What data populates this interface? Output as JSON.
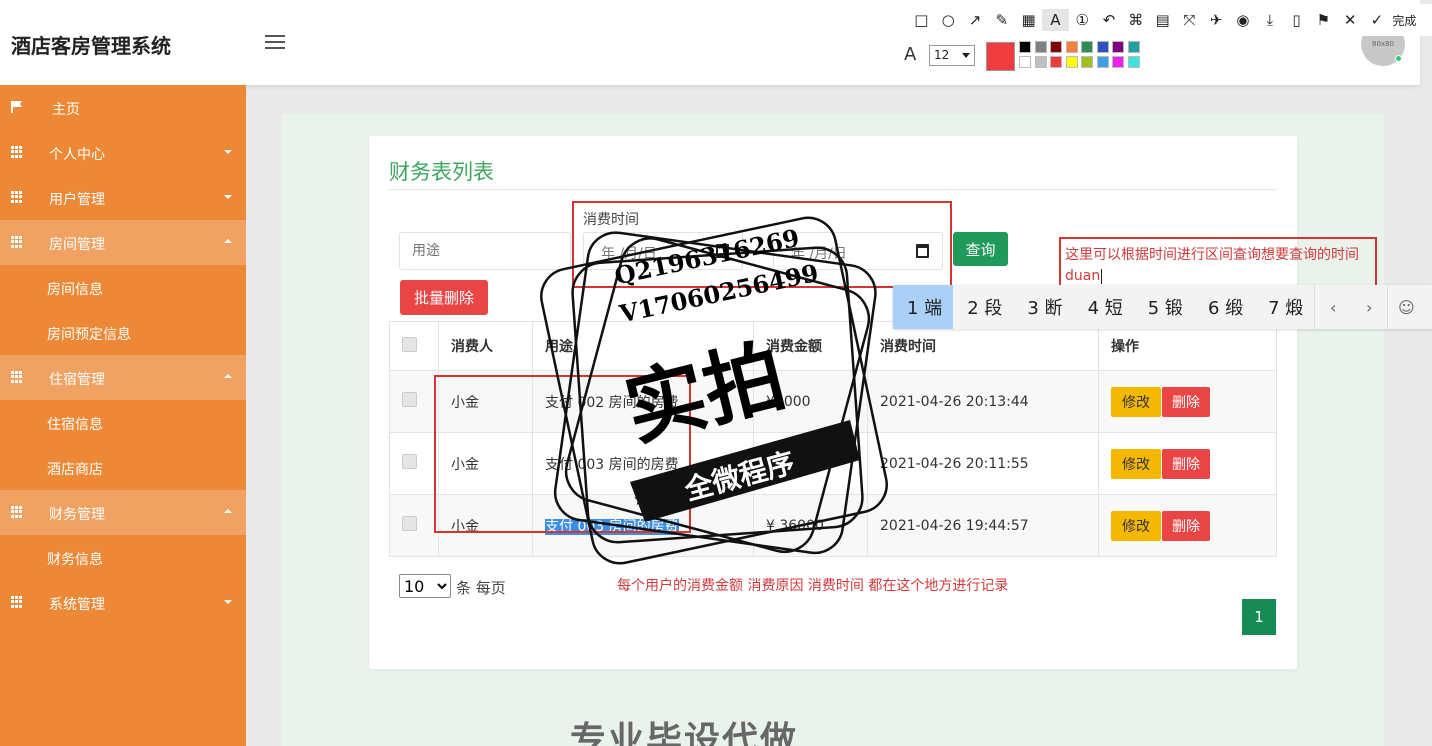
{
  "app": {
    "title": "酒店客房管理系统",
    "avatar_text": "80x80"
  },
  "sidebar": {
    "items": [
      {
        "label": "主页",
        "icon": "flag-icon"
      },
      {
        "label": "个人中心",
        "icon": "grid-icon"
      },
      {
        "label": "用户管理",
        "icon": "grid-icon"
      },
      {
        "label": "房间管理",
        "icon": "grid-icon"
      },
      {
        "label": "房间信息"
      },
      {
        "label": "房间预定信息"
      },
      {
        "label": "住宿管理",
        "icon": "grid-icon"
      },
      {
        "label": "住宿信息"
      },
      {
        "label": "酒店商店"
      },
      {
        "label": "财务管理",
        "icon": "grid-icon"
      },
      {
        "label": "财务信息"
      },
      {
        "label": "系统管理",
        "icon": "grid-icon"
      }
    ],
    "color": "#ed8936"
  },
  "main": {
    "title": "财务表列表",
    "search": {
      "purpose_placeholder": "用途",
      "time_label": "消费时间",
      "date_placeholder": "年 /月/日",
      "query_label": "查询"
    },
    "bulk_delete_label": "批量删除",
    "table": {
      "headers": [
        "消费人",
        "用途",
        "消费金额",
        "消费时间",
        "操作"
      ],
      "rows": [
        {
          "person": "小金",
          "purpose": "支付 002 房间的房费",
          "amount": "¥1000",
          "time": "2021-04-26 20:13:44"
        },
        {
          "person": "小金",
          "purpose": "支付 003 房间的房费",
          "amount": "¥1000",
          "time": "2021-04-26 20:11:55"
        },
        {
          "person": "小金",
          "purpose": "支付 003 房间的房费",
          "amount": "¥ 36000",
          "time": "2021-04-26 19:44:57"
        }
      ],
      "edit_label": "修改",
      "delete_label": "删除"
    },
    "page_size": "10",
    "per_page_label": "条 每页",
    "current_page": "1",
    "bottom_heading": "专业毕设代做"
  },
  "annotations": {
    "top_note": "这里可以根据时间进行区间查询想要查询的时间duan",
    "bottom_note": "每个用户的消费金额 消费原因 消费时间 都在这个地方进行记录"
  },
  "ime": {
    "candidates": [
      "1 端",
      "2 段",
      "3 断",
      "4 短",
      "5 锻",
      "6 缎",
      "7 煅"
    ]
  },
  "capture_toolbar": {
    "tools": [
      "rectangle-icon",
      "ellipse-icon",
      "arrow-icon",
      "pen-icon",
      "mosaic-icon",
      "text-icon",
      "number-icon",
      "undo-icon",
      "pin-icon",
      "ocr-icon",
      "scroll-capture-icon",
      "pin-screen-icon",
      "record-icon",
      "download-icon",
      "save-icon",
      "bookmark-icon",
      "close-icon"
    ],
    "done_label": "完成",
    "font_size": "12",
    "current_color": "#f03c3c",
    "palette": [
      "#000000",
      "#808080",
      "#800000",
      "#f08040",
      "#2e8b57",
      "#3050c0",
      "#800080",
      "#20a0a0",
      "#ffffff",
      "#c0c0c0",
      "#f03c3c",
      "#ffff00",
      "#a0c020",
      "#40a0e0",
      "#f020f0",
      "#40e0e0"
    ]
  },
  "watermark": {
    "line1": "Q2196316269",
    "line2": "V17060256499",
    "big": "实拍",
    "banner": "全微程序"
  }
}
